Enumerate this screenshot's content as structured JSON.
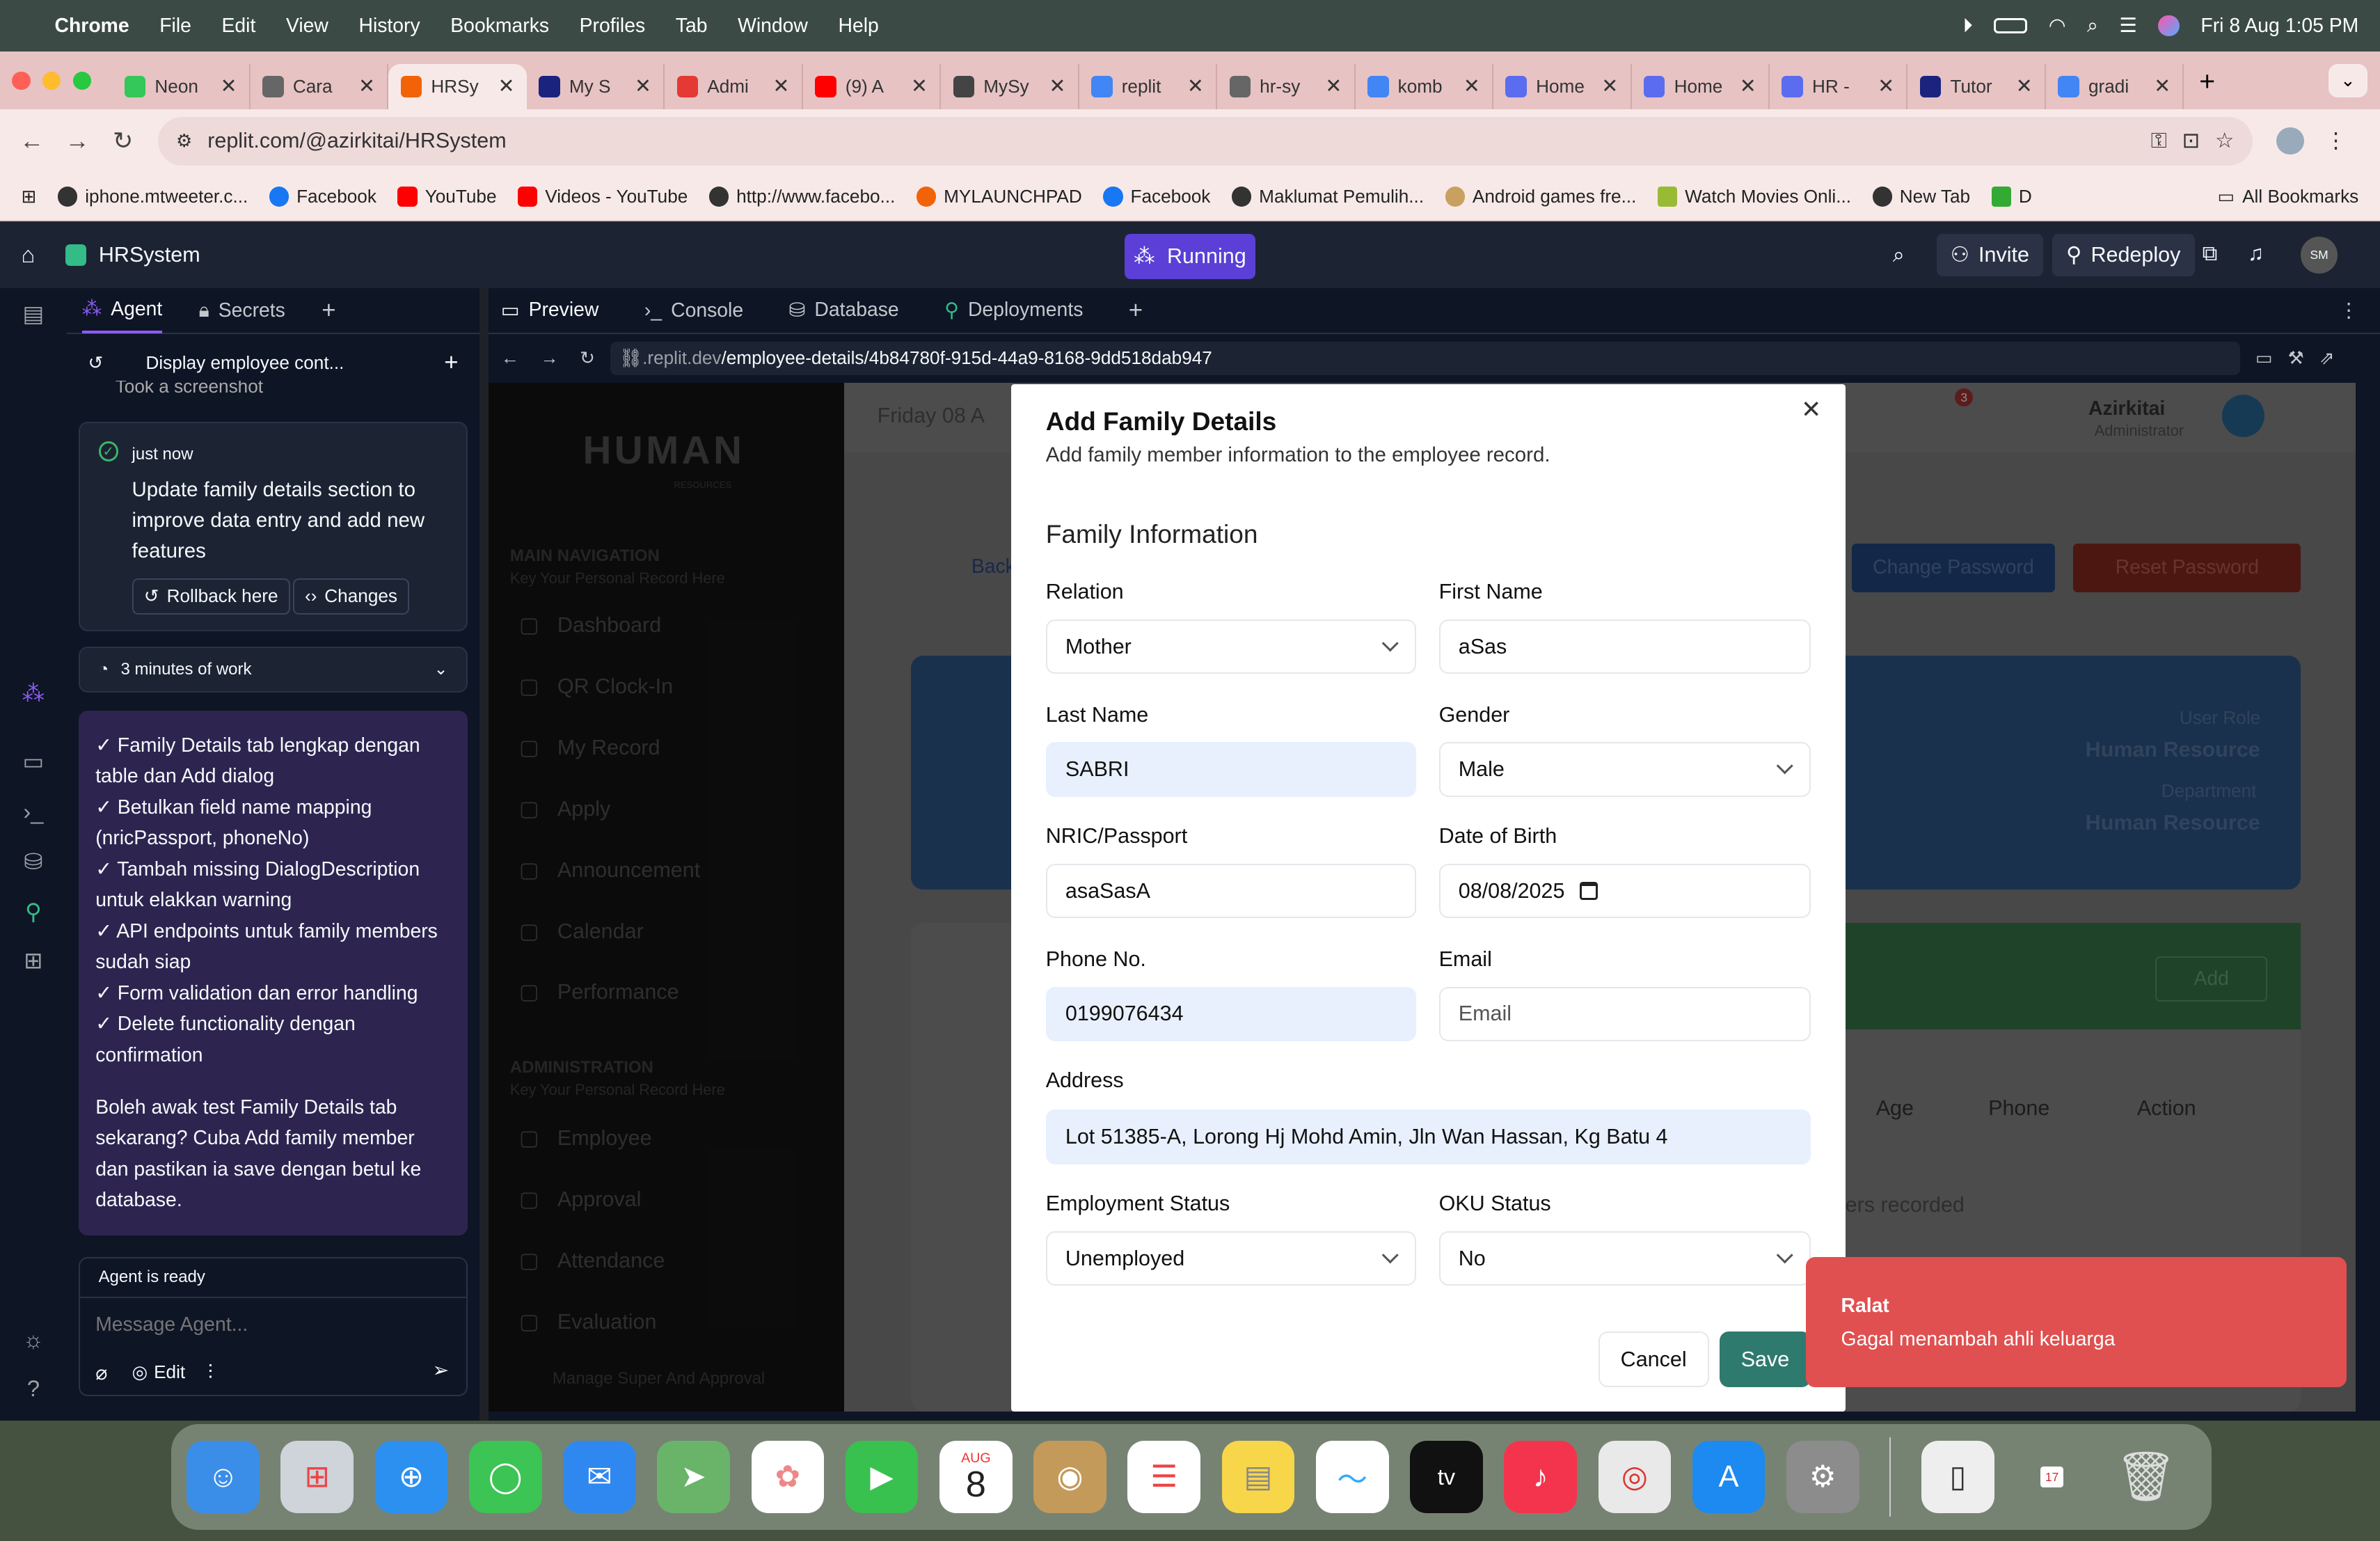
{
  "menubar": {
    "app": "Chrome",
    "items": [
      "File",
      "Edit",
      "View",
      "History",
      "Bookmarks",
      "Profiles",
      "Tab",
      "Window",
      "Help"
    ],
    "clock": "Fri 8 Aug  1:05 PM"
  },
  "tabs": [
    {
      "title": "Neon",
      "color": "#34c759"
    },
    {
      "title": "Cara",
      "color": "#666"
    },
    {
      "title": "HRSy",
      "color": "#f26207",
      "active": true
    },
    {
      "title": "My S",
      "color": "#1a237e"
    },
    {
      "title": "Admi",
      "color": "#e53935"
    },
    {
      "title": "(9) A",
      "color": "#ff0000"
    },
    {
      "title": "MySy",
      "color": "#444"
    },
    {
      "title": "replit",
      "color": "#4285f4"
    },
    {
      "title": "hr-sy",
      "color": "#666"
    },
    {
      "title": "komb",
      "color": "#4285f4"
    },
    {
      "title": "Home",
      "color": "#5b6cf0"
    },
    {
      "title": "Home",
      "color": "#5b6cf0"
    },
    {
      "title": "HR -",
      "color": "#5b6cf0"
    },
    {
      "title": "Tutor",
      "color": "#1a237e"
    },
    {
      "title": "gradi",
      "color": "#4285f4"
    }
  ],
  "url": "replit.com/@azirkitai/HRSystem",
  "bookmarks": [
    "iphone.mtweeter.c...",
    "Facebook",
    "YouTube",
    "Videos - YouTube",
    "http://www.facebo...",
    "MYLAUNCHPAD",
    "Facebook",
    "Maklumat Pemulih...",
    "Android games fre...",
    "Watch Movies Onli...",
    "New Tab",
    "D"
  ],
  "all_bookmarks": "All Bookmarks",
  "replit": {
    "project": "HRSystem",
    "status": "Running",
    "invite": "Invite",
    "redeploy": "Redeploy",
    "avatar": "SM"
  },
  "agent": {
    "tabs": [
      "Agent",
      "Secrets"
    ],
    "thread": "Display employee cont...",
    "prev_step": "Took a screenshot",
    "checkpoint_time": "just now",
    "checkpoint_text": "Update family details section to improve data entry and add new features",
    "rollback": "Rollback here",
    "changes": "Changes",
    "work": "3 minutes of work",
    "message_lines": [
      "✓ Family Details tab lengkap dengan table dan Add dialog",
      "✓ Betulkan field name mapping (nricPassport, phoneNo)",
      "✓ Tambah missing DialogDescription untuk elakkan warning",
      "✓ API endpoints untuk family members sudah siap",
      "✓ Form validation dan error handling",
      "✓ Delete functionality dengan confirmation"
    ],
    "message_question": "Boleh awak test Family Details tab sekarang? Cuba Add family member dan pastikan ia save dengan betul ke database.",
    "status": "Agent is ready",
    "input_placeholder": "Message Agent...",
    "edit": "Edit"
  },
  "preview": {
    "tabs": [
      "Preview",
      "Console",
      "Database",
      "Deployments"
    ],
    "url_host": ".replit.dev",
    "url_path": "/employee-details/4b84780f-915d-44a9-8168-9dd518dab947"
  },
  "bg_app": {
    "logo": "HUMAN",
    "logo_sub": "RESOURCES",
    "nav_title": "MAIN NAVIGATION",
    "nav_sub": "Key Your Personal Record Here",
    "nav": [
      "Dashboard",
      "QR Clock-In",
      "My Record",
      "Apply",
      "Announcement",
      "Calendar",
      "Performance"
    ],
    "admin_title": "ADMINISTRATION",
    "admin_sub": "Key Your Personal Record Here",
    "admin": [
      "Employee",
      "Approval",
      "Attendance",
      "Evaluation"
    ],
    "footer": "Manage Super And Approval",
    "date": "Friday 08 A",
    "user": "Azirkitai",
    "role": "Administrator",
    "badge": "3",
    "back": "Back",
    "change_pw": "Change Password",
    "reset_pw": "Reset Password",
    "user_role_lbl": "User Role",
    "user_role": "Human Resource",
    "dept_lbl": "Department",
    "dept": "Human Resource",
    "add": "Add",
    "cols": [
      "Age",
      "Phone",
      "Action"
    ],
    "empty": "bers recorded"
  },
  "modal": {
    "title": "Add Family Details",
    "subtitle": "Add family member information to the employee record.",
    "section": "Family Information",
    "relation_lbl": "Relation",
    "relation": "Mother",
    "first_lbl": "First Name",
    "first": "aSas",
    "last_lbl": "Last Name",
    "last": "SABRI",
    "gender_lbl": "Gender",
    "gender": "Male",
    "nric_lbl": "NRIC/Passport",
    "nric": "asaSasA",
    "dob_lbl": "Date of Birth",
    "dob": "08/08/2025",
    "phone_lbl": "Phone No.",
    "phone": "0199076434",
    "email_lbl": "Email",
    "email_ph": "Email",
    "addr_lbl": "Address",
    "addr": "Lot 51385-A, Lorong Hj Mohd Amin, Jln Wan Hassan, Kg Batu 4",
    "emp_lbl": "Employment Status",
    "emp": "Unemployed",
    "oku_lbl": "OKU Status",
    "oku": "No",
    "cancel": "Cancel",
    "save": "Save"
  },
  "toast": {
    "title": "Ralat",
    "message": "Gagal menambah ahli keluarga"
  },
  "dock": {
    "calendar_month": "AUG",
    "calendar_day": "8",
    "tv": "tv",
    "mini_cal": "17"
  }
}
